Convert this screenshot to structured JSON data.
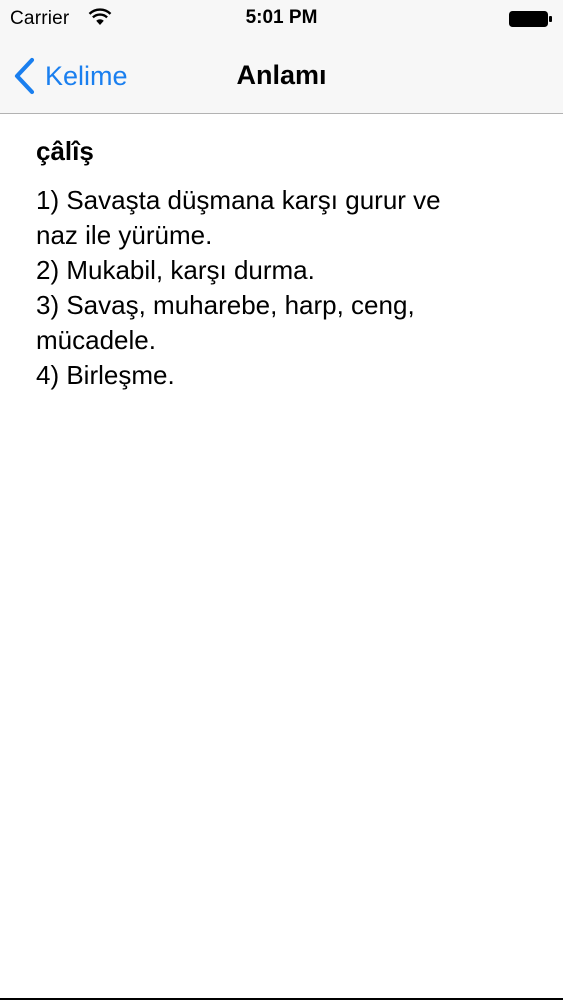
{
  "status_bar": {
    "carrier": "Carrier",
    "time": "5:01 PM"
  },
  "nav": {
    "back_label": "Kelime",
    "title": "Anlamı"
  },
  "entry": {
    "word": "çâlîş",
    "meanings": [
      "1) Savaşta düşmana karşı gurur ve",
      "naz ile yürüme.",
      "2) Mukabil, karşı durma.",
      "3) Savaş, muharebe, harp, ceng,",
      "mücadele.",
      "4) Birleşme."
    ]
  },
  "colors": {
    "accent": "#1a7fef",
    "bar_background": "#f7f7f7",
    "separator": "#b2b2b2"
  }
}
